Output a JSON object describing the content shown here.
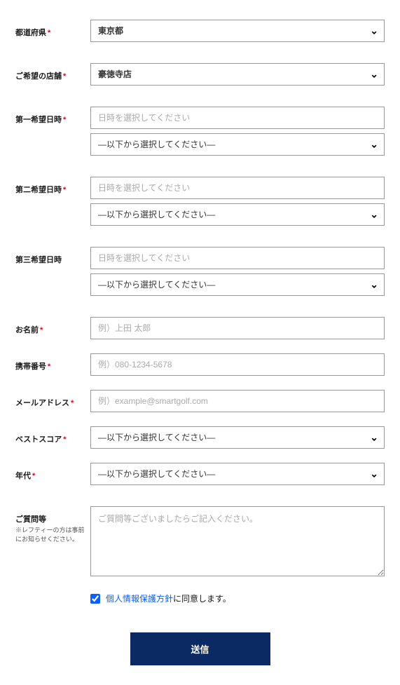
{
  "fields": {
    "prefecture": {
      "label": "都道府県",
      "value": "東京都"
    },
    "store": {
      "label": "ご希望の店舗",
      "value": "豪徳寺店"
    },
    "date1": {
      "label": "第一希望日時",
      "date_placeholder": "日時を選択してください",
      "select_placeholder": "―以下から選択してください―"
    },
    "date2": {
      "label": "第二希望日時",
      "date_placeholder": "日時を選択してください",
      "select_placeholder": "―以下から選択してください―"
    },
    "date3": {
      "label": "第三希望日時",
      "date_placeholder": "日時を選択してください",
      "select_placeholder": "―以下から選択してください―"
    },
    "name": {
      "label": "お名前",
      "placeholder": "例）上田 太郎"
    },
    "phone": {
      "label": "携帯番号",
      "placeholder": "例）080-1234-5678"
    },
    "email": {
      "label": "メールアドレス",
      "placeholder": "例）example@smartgolf.com"
    },
    "best_score": {
      "label": "ベストスコア",
      "select_placeholder": "―以下から選択してください―"
    },
    "age": {
      "label": "年代",
      "select_placeholder": "―以下から選択してください―"
    },
    "question": {
      "label": "ご質問等",
      "sublabel": "※レフティーの方は事前にお知らせください。",
      "placeholder": "ご質問等ございましたらご記入ください。"
    }
  },
  "consent": {
    "link_text": "個人情報保護方針",
    "suffix": "に同意します。"
  },
  "submit_label": "送信"
}
